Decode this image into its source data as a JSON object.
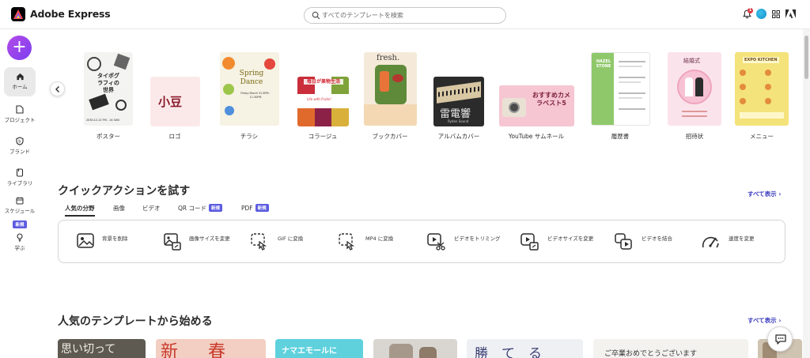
{
  "app": {
    "name": "Adobe Express"
  },
  "search": {
    "placeholder": "すべてのテンプレートを検索"
  },
  "header": {
    "notification_count": "1"
  },
  "sidebar": {
    "create_label": "+",
    "items": [
      {
        "label": "ホーム",
        "icon": "home-icon"
      },
      {
        "label": "プロジェクト",
        "icon": "project-icon"
      },
      {
        "label": "ブランド",
        "icon": "brand-icon"
      },
      {
        "label": "ライブラリ",
        "icon": "library-icon"
      },
      {
        "label": "スケジュール",
        "icon": "calendar-icon",
        "badge": "新規"
      },
      {
        "label": "学ぶ",
        "icon": "learn-icon"
      }
    ]
  },
  "categories": [
    {
      "label": "ポスター",
      "thumb_text": "タイポグラフィの世界",
      "thumb_sub": "2030.12.12 FRI - 14 SUN"
    },
    {
      "label": "ロゴ",
      "thumb_text": "小豆"
    },
    {
      "label": "チラシ",
      "thumb_text": "Spring Dance",
      "thumb_sub": "Friday March 31 8PM - 11:30PM"
    },
    {
      "label": "コラージュ",
      "thumb_text": "毎日が果物生活",
      "thumb_sub": "Life with Fruits!"
    },
    {
      "label": "ブックカバー",
      "thumb_text": "fresh."
    },
    {
      "label": "アルバムカバー",
      "thumb_text": "雷電響",
      "thumb_sub": "Ryden Sound"
    },
    {
      "label": "YouTube サムネール",
      "thumb_text": "おすすめカメラベスト5"
    },
    {
      "label": "履歴書",
      "thumb_text": "HAZEL STONE"
    },
    {
      "label": "招待状",
      "thumb_text": "結婚式"
    },
    {
      "label": "メニュー",
      "thumb_text": "EXPO KITCHEN"
    }
  ],
  "quick_actions": {
    "title": "クイックアクションを試す",
    "see_all": "すべて表示",
    "tabs": [
      {
        "label": "人気の分野"
      },
      {
        "label": "画像"
      },
      {
        "label": "ビデオ"
      },
      {
        "label": "QR コード",
        "badge": "新規"
      },
      {
        "label": "PDF",
        "badge": "新規"
      }
    ],
    "items": [
      {
        "label": "背景を削除",
        "icon": "remove-background-icon"
      },
      {
        "label": "画像サイズを変更",
        "icon": "resize-image-icon"
      },
      {
        "label": "GIF に変換",
        "icon": "convert-gif-icon"
      },
      {
        "label": "MP4 に変換",
        "icon": "convert-mp4-icon"
      },
      {
        "label": "ビデオをトリミング",
        "icon": "trim-video-icon"
      },
      {
        "label": "ビデオサイズを変更",
        "icon": "resize-video-icon"
      },
      {
        "label": "ビデオを結合",
        "icon": "merge-video-icon"
      },
      {
        "label": "速度を変更",
        "icon": "change-speed-icon"
      }
    ]
  },
  "popular": {
    "title": "人気のテンプレートから始める",
    "see_all": "すべて表示",
    "cards": [
      {
        "text": "思い切って"
      },
      {
        "text": "新　春"
      },
      {
        "text": "ナマエモールに"
      },
      {
        "text": ""
      },
      {
        "text": "勝　て　る"
      },
      {
        "text": "ご卒業おめでとうございます"
      },
      {
        "text": ""
      }
    ]
  },
  "colors": {
    "accent": "#5c5ce0",
    "create_gradient_start": "#b44be8",
    "create_gradient_end": "#7b3ef0",
    "link": "#3b3bbf"
  }
}
